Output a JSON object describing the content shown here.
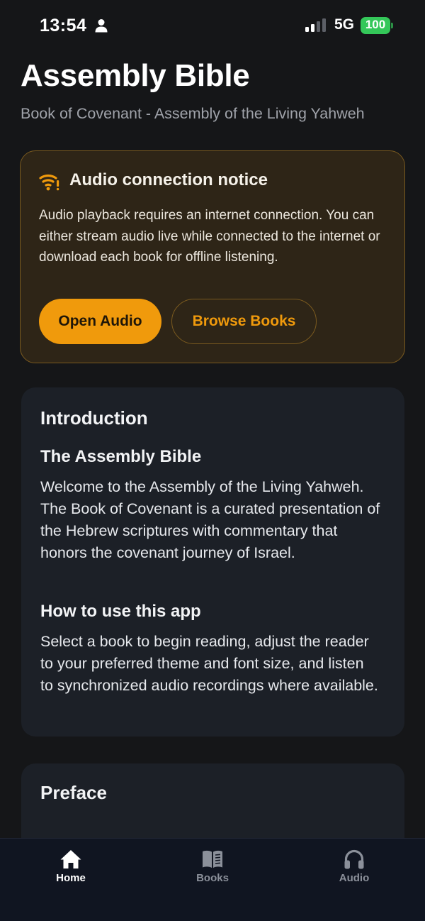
{
  "status_bar": {
    "time": "13:54",
    "network": "5G",
    "battery": "100",
    "icons": [
      "person-icon",
      "signal-icon",
      "battery-icon"
    ]
  },
  "header": {
    "title": "Assembly Bible",
    "subtitle": "Book of Covenant - Assembly of the Living Yahweh"
  },
  "notice": {
    "icon": "wifi-warning-icon",
    "title": "Audio connection notice",
    "body": "Audio playback requires an internet connection. You can either stream audio live while connected to the internet or download each book for offline listening.",
    "primary_button": "Open Audio",
    "secondary_button": "Browse Books",
    "accent_color": "#f09a0c"
  },
  "introduction": {
    "heading": "Introduction",
    "sections": [
      {
        "heading": "The Assembly Bible",
        "body": "Welcome to the Assembly of the Living Yahweh. The Book of Covenant is a curated presentation of the Hebrew scriptures with commentary that honors the covenant journey of Israel."
      },
      {
        "heading": "How to use this app",
        "body": "Select a book to begin reading, adjust the reader to your preferred theme and font size, and listen to synchronized audio recordings where available."
      }
    ]
  },
  "preface": {
    "heading": "Preface"
  },
  "tab_bar": {
    "tabs": [
      {
        "label": "Home",
        "icon": "home-icon",
        "active": true
      },
      {
        "label": "Books",
        "icon": "book-icon",
        "active": false
      },
      {
        "label": "Audio",
        "icon": "headphones-icon",
        "active": false
      }
    ]
  }
}
